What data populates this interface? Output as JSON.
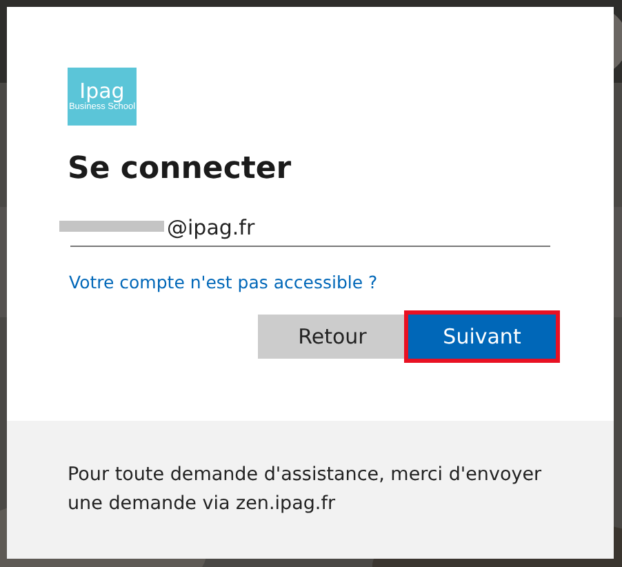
{
  "logo": {
    "name": "Ipag",
    "subtitle": "Business School"
  },
  "title": "Se connecter",
  "email_field": {
    "value": "@ipag.fr",
    "redacted": true
  },
  "link": "Votre compte n'est pas accessible ?",
  "buttons": [
    {
      "label": "Retour",
      "kind": "secondary",
      "focused": false
    },
    {
      "label": "Suivant",
      "kind": "primary",
      "focused": true
    }
  ],
  "footer": "Pour toute demande d'assistance, merci d'envoyer une demande via zen.ipag.fr"
}
